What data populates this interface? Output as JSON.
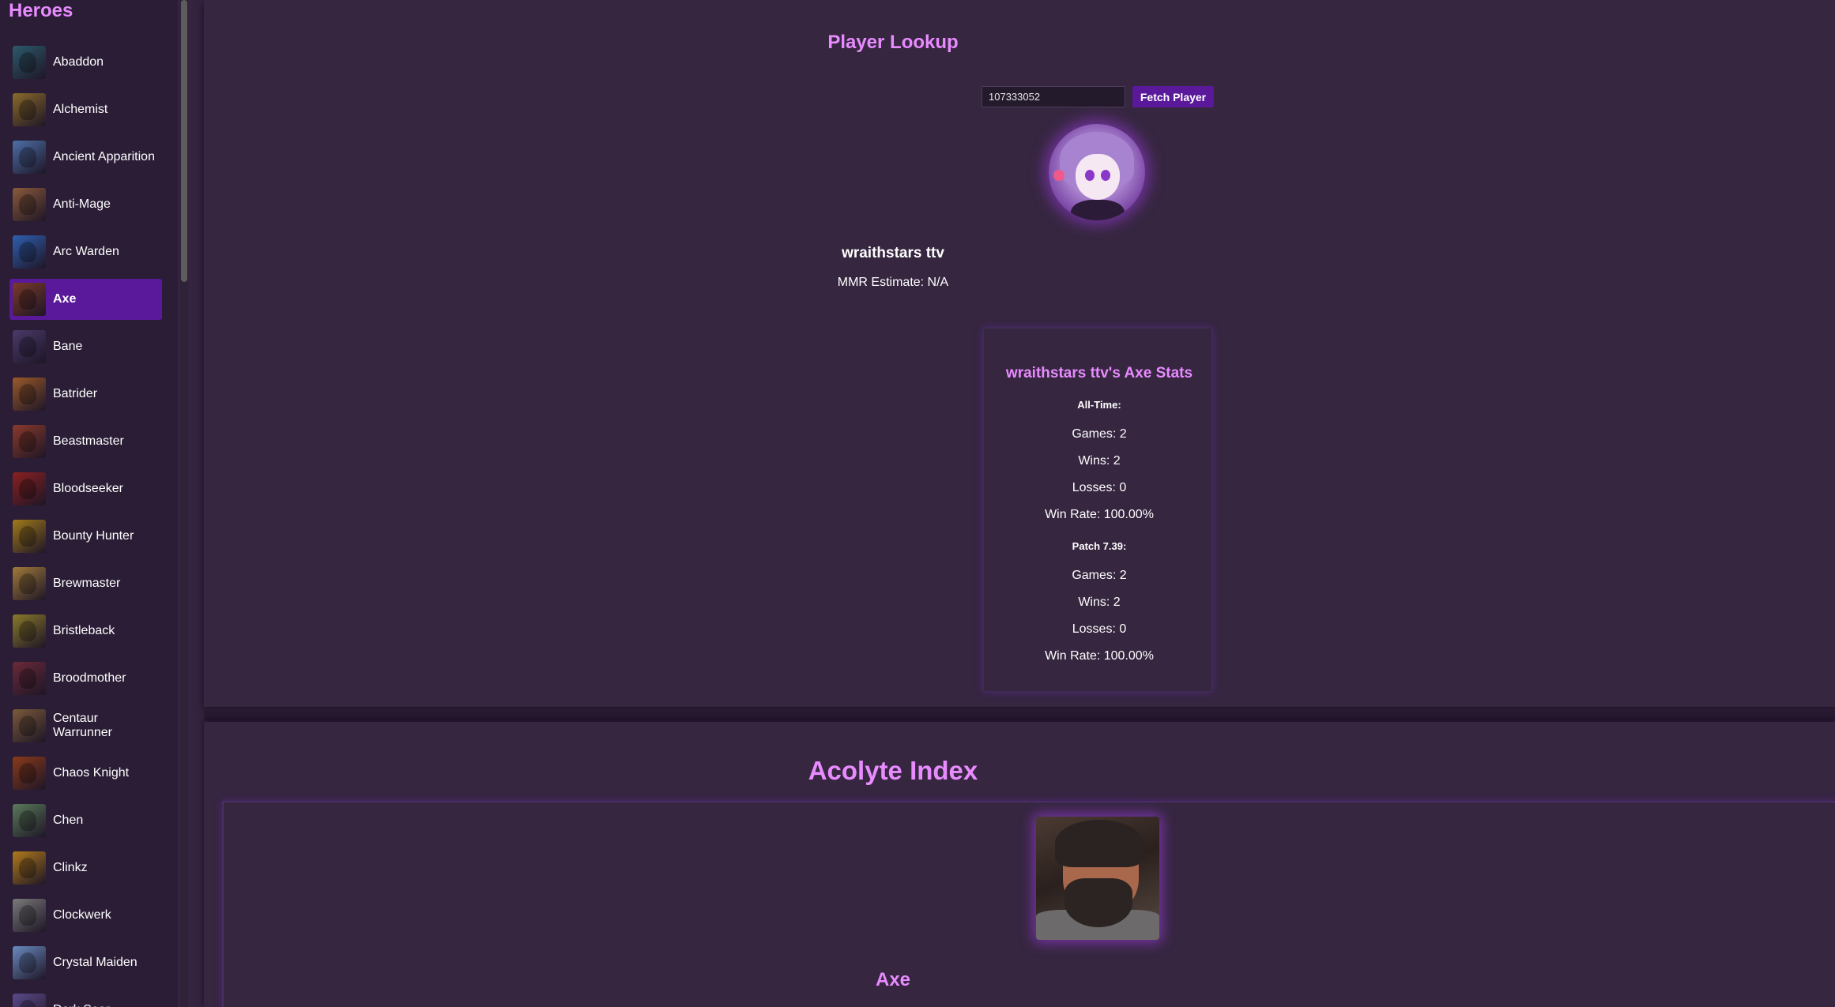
{
  "sidebar": {
    "title": "Heroes",
    "heroes": [
      {
        "label": "Abaddon",
        "color": "#2c5a6b"
      },
      {
        "label": "Alchemist",
        "color": "#8a6a2a"
      },
      {
        "label": "Ancient Apparition",
        "color": "#4d6fa8"
      },
      {
        "label": "Anti-Mage",
        "color": "#8a5a3a"
      },
      {
        "label": "Arc Warden",
        "color": "#2f5fb0"
      },
      {
        "label": "Axe",
        "color": "#7a3a2a",
        "active": true
      },
      {
        "label": "Bane",
        "color": "#4a3a6a"
      },
      {
        "label": "Batrider",
        "color": "#9a5a2a"
      },
      {
        "label": "Beastmaster",
        "color": "#8a3a2a"
      },
      {
        "label": "Bloodseeker",
        "color": "#8a2020"
      },
      {
        "label": "Bounty Hunter",
        "color": "#a07a1a"
      },
      {
        "label": "Brewmaster",
        "color": "#a07a3a"
      },
      {
        "label": "Bristleback",
        "color": "#8a7a2a"
      },
      {
        "label": "Broodmother",
        "color": "#6a2a3a"
      },
      {
        "label": "Centaur Warrunner",
        "color": "#7a5a3a"
      },
      {
        "label": "Chaos Knight",
        "color": "#8a3a1a"
      },
      {
        "label": "Chen",
        "color": "#5a7a5a"
      },
      {
        "label": "Clinkz",
        "color": "#b07a1a"
      },
      {
        "label": "Clockwerk",
        "color": "#7a7a7a"
      },
      {
        "label": "Crystal Maiden",
        "color": "#6a8ac0"
      },
      {
        "label": "Dark Seer",
        "color": "#5a4a8a"
      }
    ]
  },
  "player_lookup": {
    "title": "Player Lookup",
    "player_id_value": "107333052",
    "fetch_button_label": "Fetch Player",
    "player_name": "wraithstars ttv",
    "mmr_estimate": "MMR Estimate: N/A"
  },
  "stats": {
    "title": "wraithstars ttv's Axe Stats",
    "all_time": {
      "label": "All-Time:",
      "games": "Games: 2",
      "wins": "Wins: 2",
      "losses": "Losses: 0",
      "win_rate": "Win Rate: 100.00%"
    },
    "patch": {
      "label": "Patch 7.39:",
      "games": "Games: 2",
      "wins": "Wins: 2",
      "losses": "Losses: 0",
      "win_rate": "Win Rate: 100.00%"
    }
  },
  "acolyte_index": {
    "title": "Acolyte Index",
    "hero_name": "Axe"
  },
  "colors": {
    "accent_pink": "#e88bff",
    "accent_purple": "#5a189a",
    "background": "#34243f"
  }
}
